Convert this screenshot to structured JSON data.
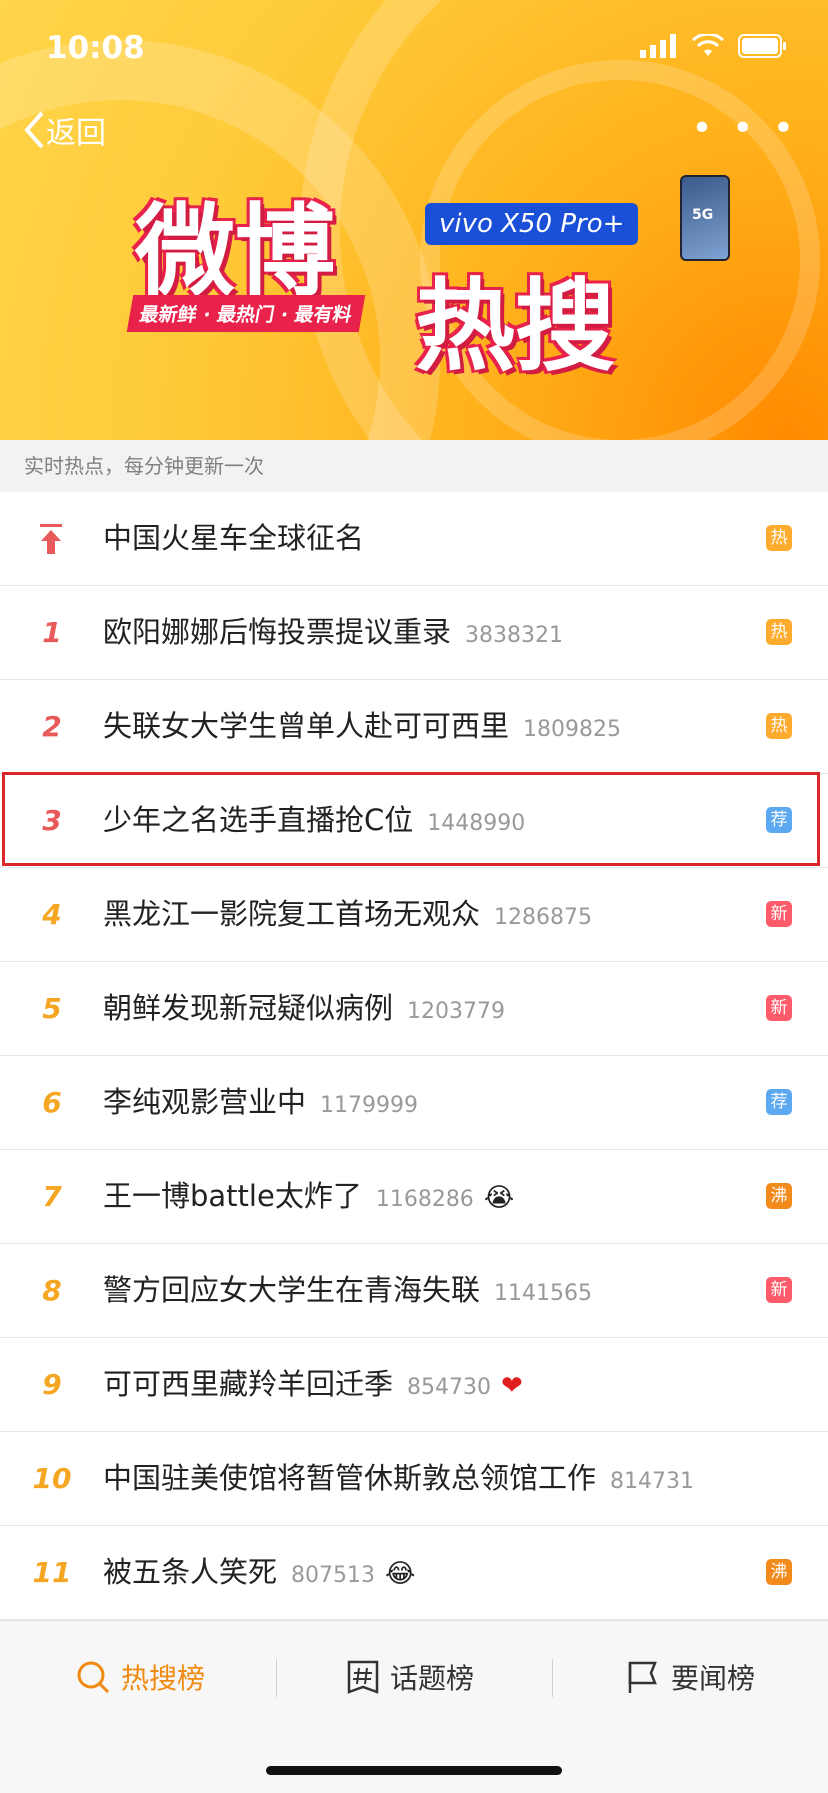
{
  "status_bar": {
    "time": "10:08"
  },
  "nav": {
    "back_label": "返回",
    "more_label": "• • •"
  },
  "banner": {
    "logo_word_1": "微博",
    "logo_word_2": "热搜",
    "slogan": "最新鲜 · 最热门 · 最有料",
    "sponsor": "vivo X50 Pro+",
    "phone_tag": "5G"
  },
  "subheader": "实时热点，每分钟更新一次",
  "list": [
    {
      "rank": "",
      "pinned": true,
      "title": "中国火星车全球征名",
      "count": "",
      "emoji": "",
      "badge": "热",
      "badge_type": "hot"
    },
    {
      "rank": "1",
      "title": "欧阳娜娜后悔投票提议重录",
      "count": "3838321",
      "emoji": "",
      "badge": "热",
      "badge_type": "hot"
    },
    {
      "rank": "2",
      "title": "失联女大学生曾单人赴可可西里",
      "count": "1809825",
      "emoji": "",
      "badge": "热",
      "badge_type": "hot"
    },
    {
      "rank": "3",
      "title": "少年之名选手直播抢C位",
      "count": "1448990",
      "emoji": "",
      "badge": "荐",
      "badge_type": "rec"
    },
    {
      "rank": "4",
      "title": "黑龙江一影院复工首场无观众",
      "count": "1286875",
      "emoji": "",
      "badge": "新",
      "badge_type": "new"
    },
    {
      "rank": "5",
      "title": "朝鲜发现新冠疑似病例",
      "count": "1203779",
      "emoji": "",
      "badge": "新",
      "badge_type": "new"
    },
    {
      "rank": "6",
      "title": "李纯观影营业中",
      "count": "1179999",
      "emoji": "",
      "badge": "荐",
      "badge_type": "rec"
    },
    {
      "rank": "7",
      "title": "王一博battle太炸了",
      "count": "1168286",
      "emoji": "😭",
      "badge": "沸",
      "badge_type": "boil"
    },
    {
      "rank": "8",
      "title": "警方回应女大学生在青海失联",
      "count": "1141565",
      "emoji": "",
      "badge": "新",
      "badge_type": "new"
    },
    {
      "rank": "9",
      "title": "可可西里藏羚羊回迁季",
      "count": "854730",
      "emoji": "❤",
      "badge": "",
      "badge_type": ""
    },
    {
      "rank": "10",
      "title": "中国驻美使馆将暂管休斯敦总领馆工作",
      "count": "814731",
      "emoji": "",
      "badge": "",
      "badge_type": ""
    },
    {
      "rank": "11",
      "title": "被五条人笑死",
      "count": "807513",
      "emoji": "😂",
      "badge": "沸",
      "badge_type": "boil"
    }
  ],
  "tabs": [
    {
      "label": "热搜榜",
      "icon": "search-hot-icon",
      "active": true
    },
    {
      "label": "话题榜",
      "icon": "hashtag-icon",
      "active": false
    },
    {
      "label": "要闻榜",
      "icon": "news-flag-icon",
      "active": false
    }
  ],
  "colors": {
    "accent": "#f08a10",
    "highlight_border": "#d9272a",
    "banner": "#ffb21c"
  }
}
